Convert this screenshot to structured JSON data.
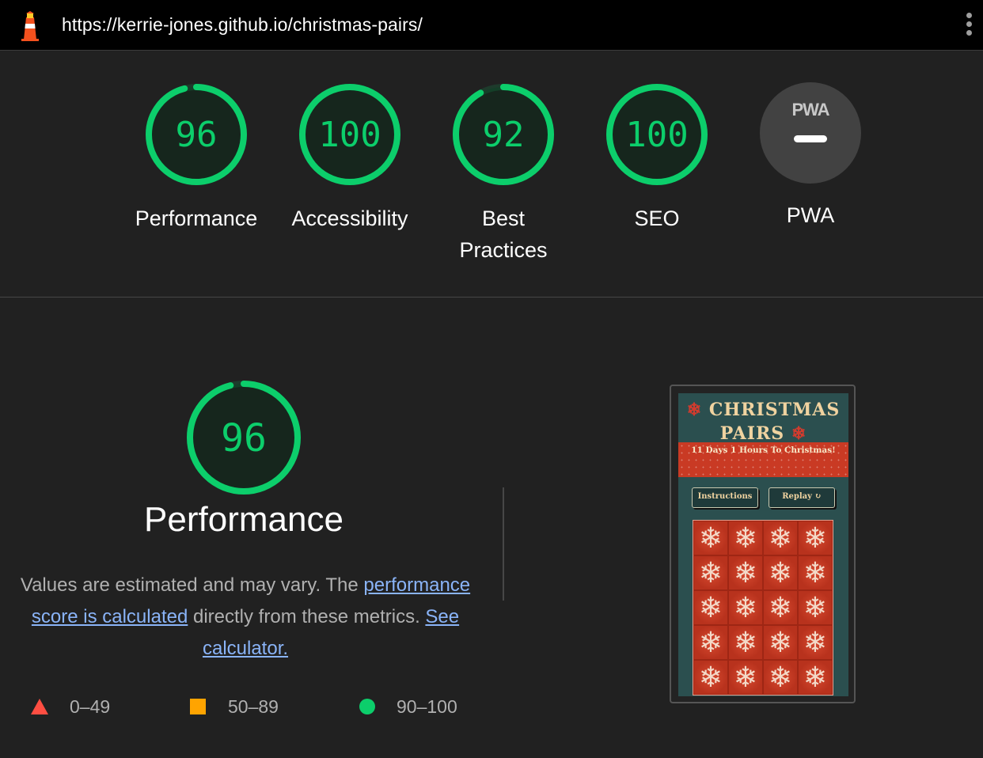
{
  "browser": {
    "url": "https://kerrie-jones.github.io/christmas-pairs/",
    "logo_icon": "lighthouse-icon",
    "menu_icon": "more-vert-icon"
  },
  "colors": {
    "pass": "#0cce6b",
    "average": "#ffa400",
    "fail": "#ff4e42",
    "background": "#212121"
  },
  "scores": [
    {
      "label": "Performance",
      "value": "96"
    },
    {
      "label": "Accessibility",
      "value": "100"
    },
    {
      "label": "Best Practices",
      "value": "92"
    },
    {
      "label": "SEO",
      "value": "100"
    },
    {
      "label": "PWA",
      "badge": "PWA"
    }
  ],
  "performance_section": {
    "score": "96",
    "title": "Performance",
    "desc_part1": "Values are estimated and may vary. The ",
    "desc_link1": "performance score is calculated",
    "desc_part2": " directly from these metrics. ",
    "desc_link2": "See calculator."
  },
  "legend": [
    {
      "range": "0–49",
      "icon": "triangle-icon"
    },
    {
      "range": "50–89",
      "icon": "square-icon"
    },
    {
      "range": "90–100",
      "icon": "circle-icon"
    }
  ],
  "screenshot": {
    "title_line1": "CHRISTMAS",
    "title_line2": "PAIRS",
    "countdown": "11 Days 1 Hours To Christmas!",
    "instructions_label": "Instructions",
    "replay_label": "Replay ↻",
    "card_symbol": "❄",
    "flake_symbol": "❄"
  }
}
